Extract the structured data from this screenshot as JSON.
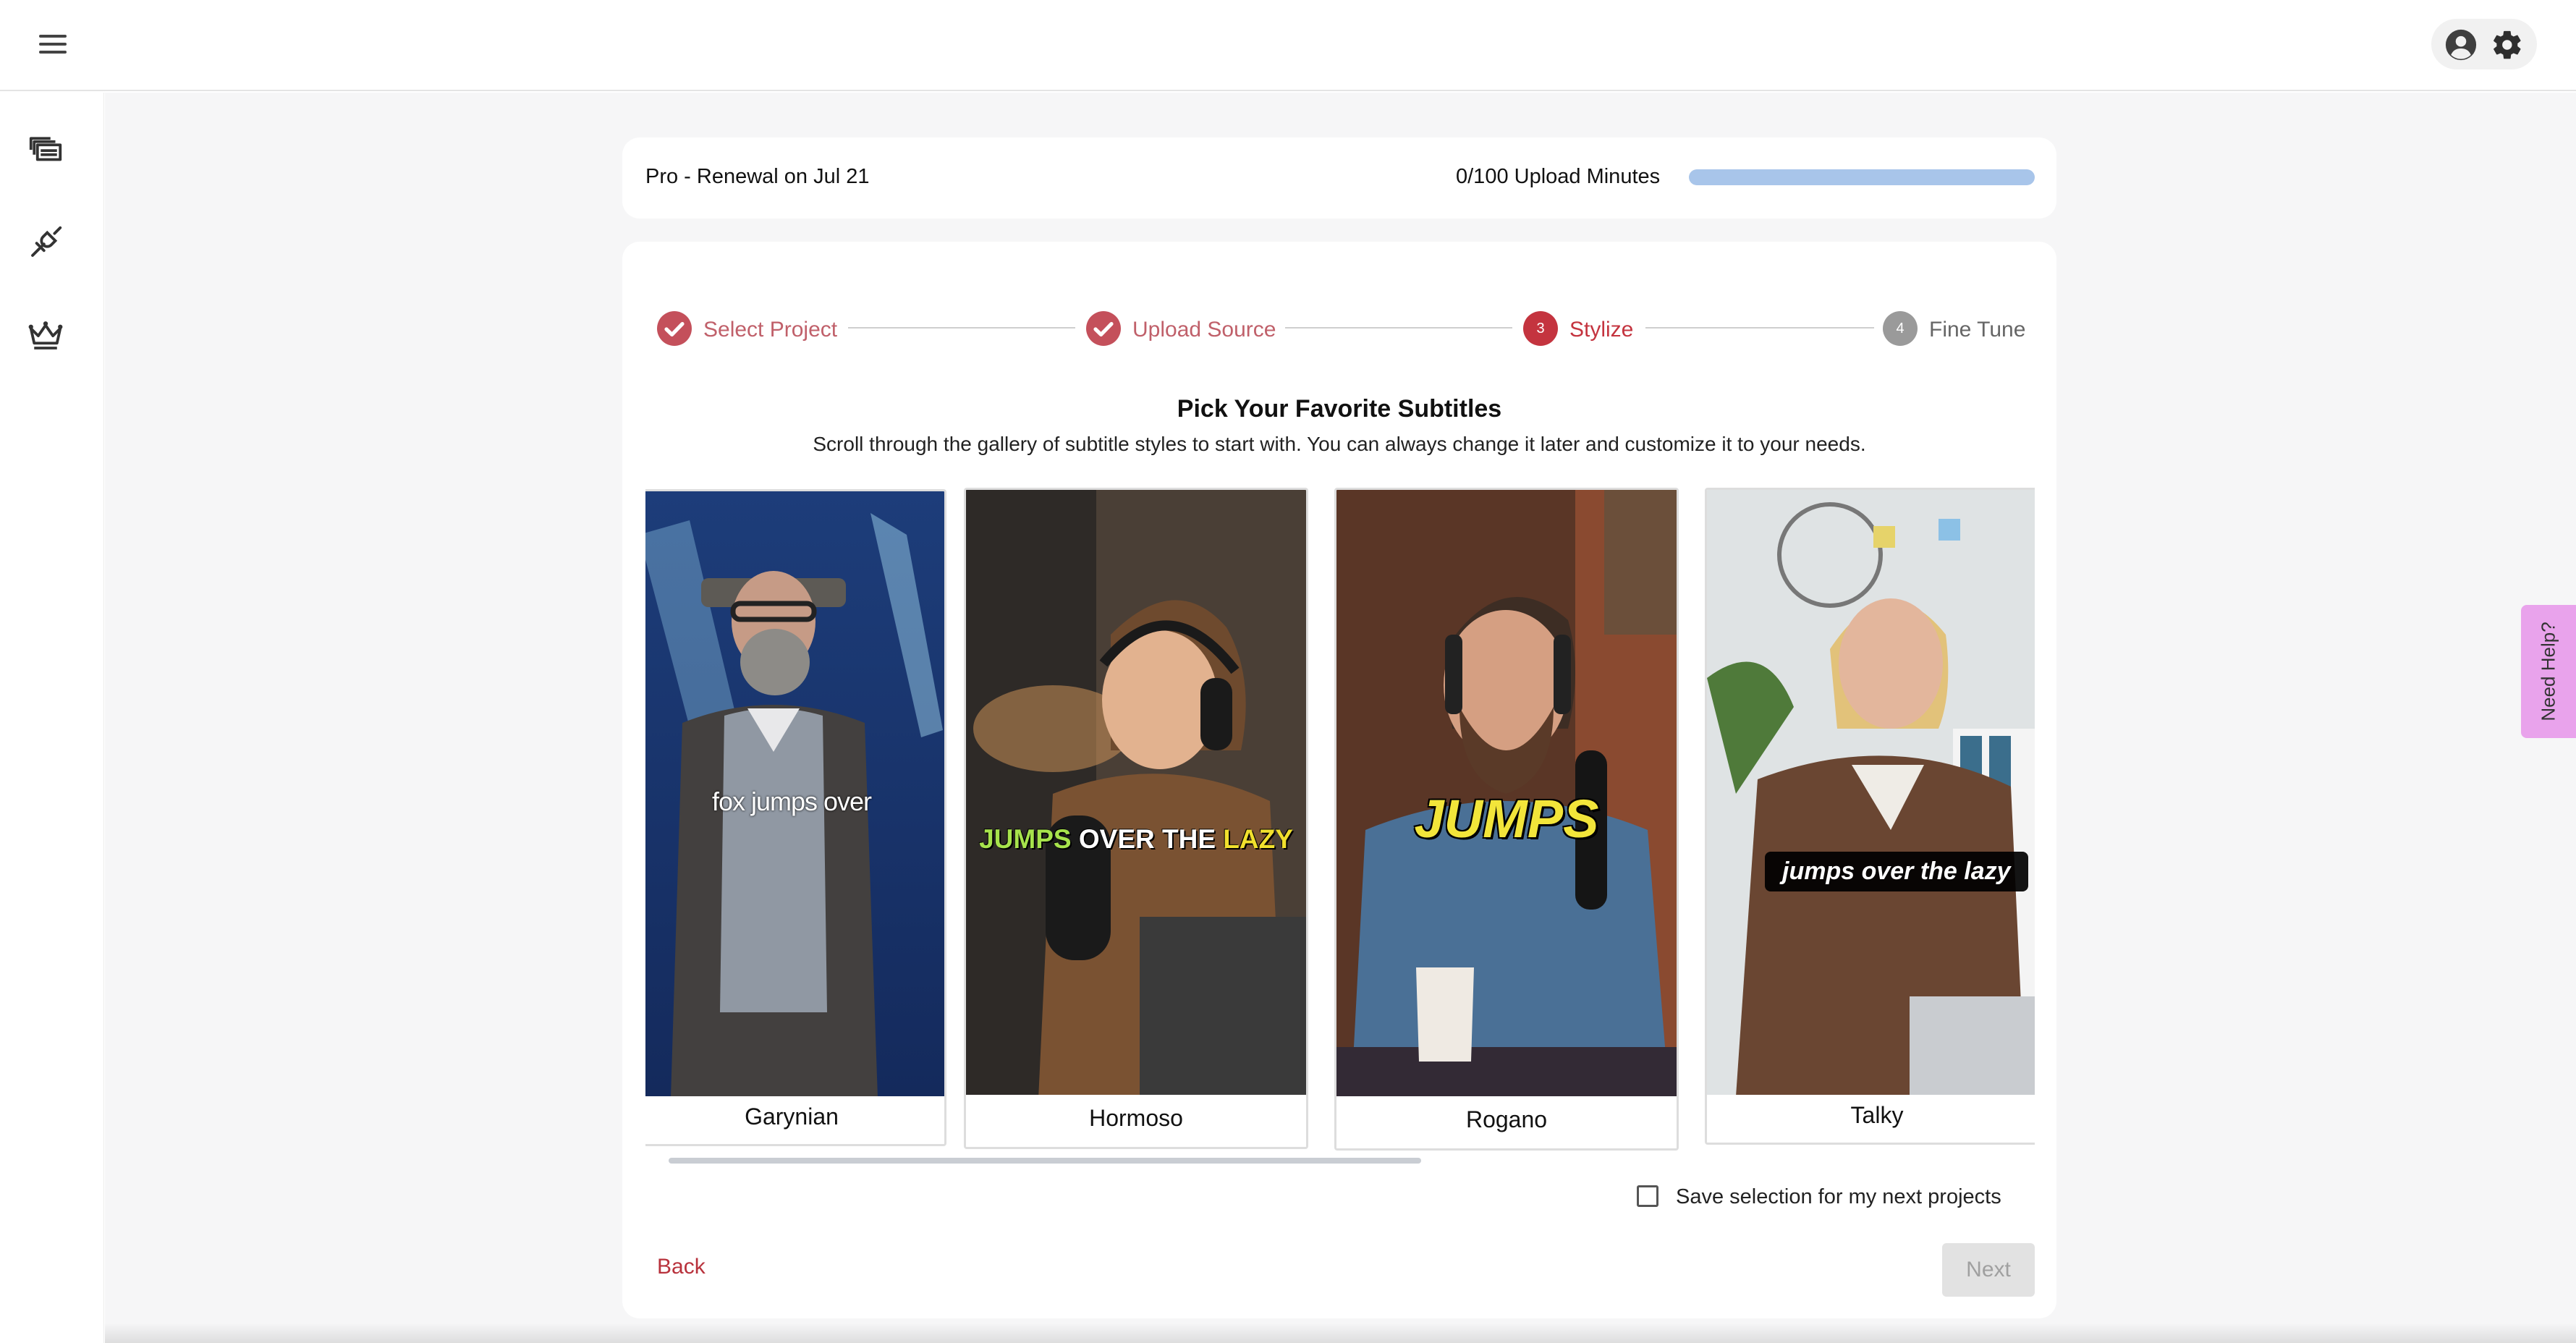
{
  "plan": {
    "label": "Pro - Renewal on Jul 21",
    "minutes_label": "0/100 Upload Minutes",
    "minutes_used_fraction": 1.0
  },
  "stepper": {
    "steps": [
      {
        "label": "Select Project",
        "state": "done",
        "number": "1"
      },
      {
        "label": "Upload Source",
        "state": "done",
        "number": "2"
      },
      {
        "label": "Stylize",
        "state": "active",
        "number": "3"
      },
      {
        "label": "Fine Tune",
        "state": "todo",
        "number": "4"
      }
    ]
  },
  "content": {
    "heading": "Pick Your Favorite Subtitles",
    "subheading": "Scroll through the gallery of subtitle styles to start with. You can always change it later and customize it to your needs."
  },
  "gallery": {
    "styles": [
      {
        "name": "Garynian",
        "caption": "fox jumps over"
      },
      {
        "name": "Hormoso",
        "caption_parts": [
          "JUMPS",
          " OVER THE ",
          "LAZY"
        ]
      },
      {
        "name": "Rogano",
        "caption": "JUMPS"
      },
      {
        "name": "Talky",
        "caption": "jumps over the lazy"
      }
    ]
  },
  "save_selection": {
    "label": "Save selection for my next projects",
    "checked": false
  },
  "actions": {
    "back": "Back",
    "next": "Next"
  },
  "help": {
    "label": "Need Help?"
  },
  "colors": {
    "accent": "#c4343f",
    "done_step": "#c4505b",
    "help_tab": "#e9a3ec",
    "progress": "#a8c5ea"
  }
}
